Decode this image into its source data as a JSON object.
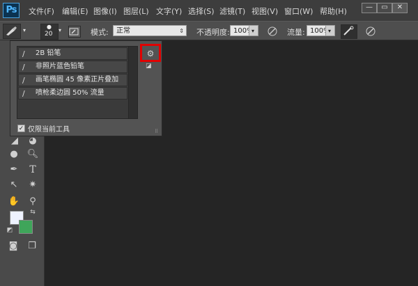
{
  "app": {
    "logo": "Ps"
  },
  "menu": [
    "文件(F)",
    "编辑(E)",
    "图像(I)",
    "图层(L)",
    "文字(Y)",
    "选择(S)",
    "滤镜(T)",
    "视图(V)",
    "窗口(W)",
    "帮助(H)"
  ],
  "window_controls": {
    "minimize": "—",
    "restore": "▭",
    "close": "✕"
  },
  "options": {
    "brush_size": "20",
    "mode_label": "模式:",
    "mode_value": "正常",
    "opacity_label": "不透明度:",
    "opacity_value": "100%",
    "flow_label": "流量:",
    "flow_value": "100%"
  },
  "tool_presets": {
    "items": [
      {
        "label": "2B 铅笔"
      },
      {
        "label": "非照片蓝色铅笔"
      },
      {
        "label": "画笔椭圆 45 像素正片叠加"
      },
      {
        "label": "喷枪柔边圆 50% 流量"
      }
    ],
    "current_tool_only_label": "仅限当前工具",
    "current_tool_only_checked": true
  },
  "colors": {
    "foreground": "#eef2ff",
    "background": "#3fa55a",
    "highlight": "#e10000"
  },
  "icons": [
    "brush-icon",
    "gear-icon",
    "new-preset-icon",
    "pressure-icon",
    "airbrush-icon"
  ]
}
